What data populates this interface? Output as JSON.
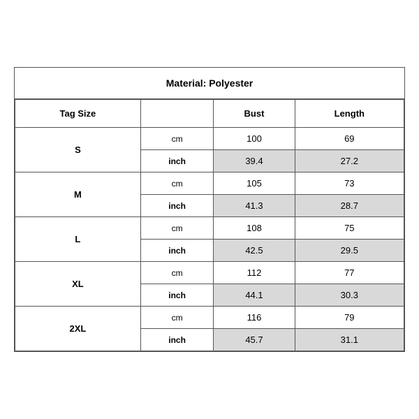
{
  "title": "Material: Polyester",
  "headers": {
    "tag_size": "Tag Size",
    "bust": "Bust",
    "length": "Length"
  },
  "rows": [
    {
      "size": "S",
      "cm": {
        "bust": "100",
        "length": "69"
      },
      "inch": {
        "bust": "39.4",
        "length": "27.2"
      }
    },
    {
      "size": "M",
      "cm": {
        "bust": "105",
        "length": "73"
      },
      "inch": {
        "bust": "41.3",
        "length": "28.7"
      }
    },
    {
      "size": "L",
      "cm": {
        "bust": "108",
        "length": "75"
      },
      "inch": {
        "bust": "42.5",
        "length": "29.5"
      }
    },
    {
      "size": "XL",
      "cm": {
        "bust": "112",
        "length": "77"
      },
      "inch": {
        "bust": "44.1",
        "length": "30.3"
      }
    },
    {
      "size": "2XL",
      "cm": {
        "bust": "116",
        "length": "79"
      },
      "inch": {
        "bust": "45.7",
        "length": "31.1"
      }
    }
  ]
}
